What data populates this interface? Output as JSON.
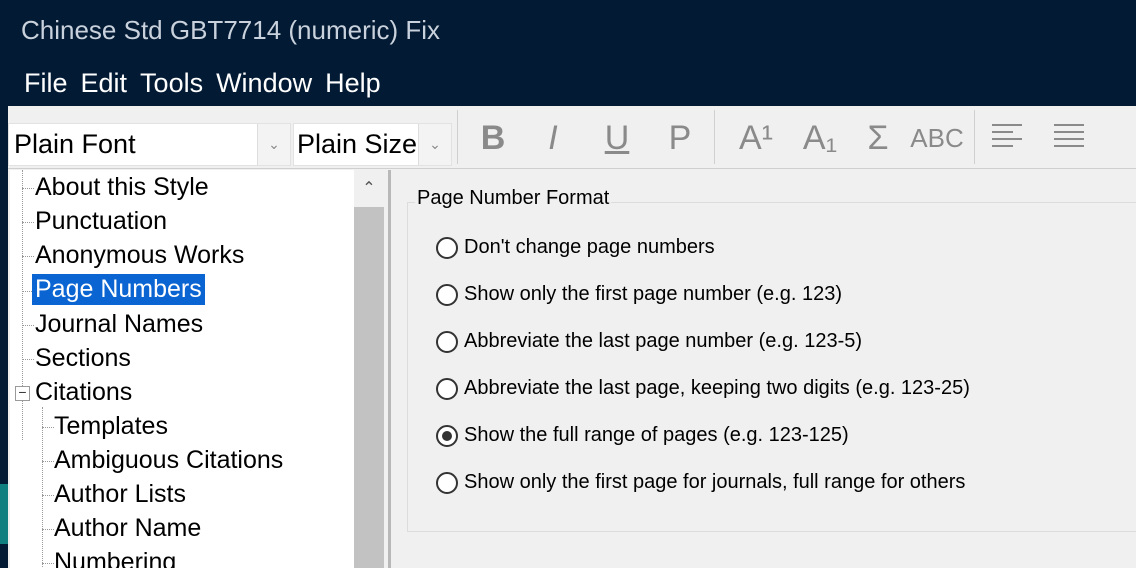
{
  "window": {
    "title": "Chinese Std GBT7714 (numeric) Fix"
  },
  "menu": [
    "File",
    "Edit",
    "Tools",
    "Window",
    "Help"
  ],
  "toolbar": {
    "font_value": "Plain Font",
    "size_value": "Plain Size",
    "buttons": [
      "B",
      "I",
      "U",
      "P",
      "A¹",
      "A₁",
      "Σ",
      "ABC"
    ]
  },
  "tree": {
    "items": [
      "About this Style",
      "Punctuation",
      "Anonymous Works",
      "Page Numbers",
      "Journal Names",
      "Sections",
      "Citations",
      "Templates",
      "Ambiguous Citations",
      "Author Lists",
      "Author Name",
      "Numbering"
    ],
    "selected": "Page Numbers"
  },
  "group": {
    "title": "Page Number Format",
    "options": [
      "Don't change page numbers",
      "Show only the first page number (e.g. 123)",
      "Abbreviate the last page number (e.g. 123-5)",
      "Abbreviate the last page, keeping two digits (e.g. 123-25)",
      "Show the full range of pages (e.g. 123-125)",
      "Show only the first page for journals, full range for others"
    ],
    "selected_index": 4
  }
}
